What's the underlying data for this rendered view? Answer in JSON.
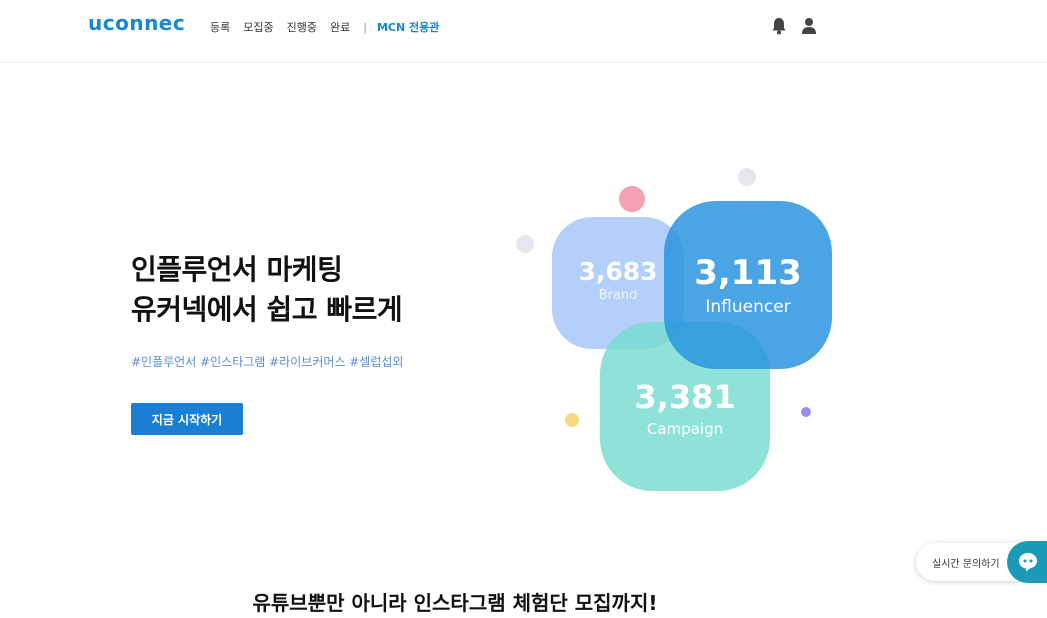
{
  "header": {
    "logo": "uconnec",
    "nav": [
      "등록",
      "모집중",
      "진행중",
      "완료"
    ],
    "separator": "|",
    "mcn": "MCN 전용관",
    "icons": [
      "bell-icon",
      "user-icon"
    ]
  },
  "hero": {
    "title_line1": "인플루언서 마케팅",
    "title_line2": "유커넥에서 쉽고 빠르게",
    "hashtags": "#인플루언서 #인스타그램 #라이브커머스 #셀럽섭외",
    "cta": "지금 시작하기"
  },
  "stats": {
    "brand": {
      "value": "3,683",
      "label": "Brand"
    },
    "influencer": {
      "value": "3,113",
      "label": "Influencer"
    },
    "campaign": {
      "value": "3,381",
      "label": "Campaign"
    }
  },
  "section": {
    "title": "유튜브뿐만 아니라 인스타그램 체험단 모집까지!"
  },
  "chat": {
    "label": "실시간 문의하기",
    "icon": "chat-bubble-icon"
  },
  "colors": {
    "accent": "#1a86d0",
    "brand_blob": "#8cb5f7",
    "influencer_blob": "#2391de",
    "campaign_blob": "#75dcd0",
    "chat": "#1b9bb6"
  }
}
